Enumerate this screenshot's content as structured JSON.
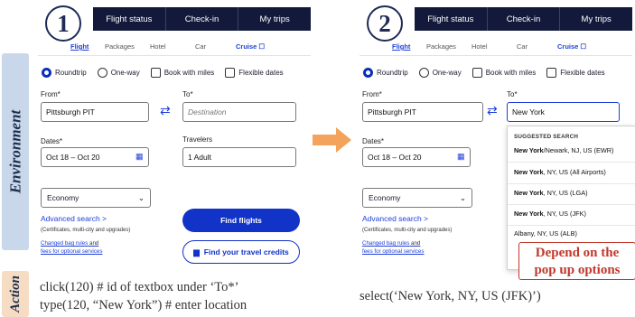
{
  "side_labels": {
    "environment": "Environment",
    "action": "Action"
  },
  "nav": {
    "items": [
      "Flight status",
      "Check-in",
      "My trips"
    ]
  },
  "steps": {
    "one": "1",
    "two": "2"
  },
  "tabs": {
    "flight": "Flight",
    "packages": "Packages",
    "hotel": "Hotel",
    "car": "Car",
    "cruise": "Cruise ☐"
  },
  "trip_options": {
    "roundtrip": "Roundtrip",
    "oneway": "One-way",
    "miles": "Book with miles",
    "flexible": "Flexible dates"
  },
  "form": {
    "from_label": "From*",
    "to_label": "To*",
    "from_value": "Pittsburgh PIT",
    "to_placeholder": "Destination",
    "to_value": "New York",
    "dates_label": "Dates*",
    "dates_value": "Oct 18 – Oct 20",
    "travelers_label": "Travelers",
    "travelers_value": "1 Adult",
    "cabin_value": "Economy",
    "advanced_label": "Advanced search >",
    "advanced_note": "(Certificates, multi-city and upgrades)",
    "bag_rules_1": "Changed bag rules",
    "bag_rules_and": " and",
    "bag_rules_2": "fees for optional services",
    "find_flights": "Find flights",
    "travel_credits": "Find your travel credits"
  },
  "suggestions": {
    "header": "SUGGESTED SEARCH",
    "items": [
      {
        "bold": "New York",
        "rest": "/Newark, NJ, US (EWR)"
      },
      {
        "bold": "New York",
        "rest": ", NY, US (All Airports)"
      },
      {
        "bold": "New York",
        "rest": ", NY, US (LGA)"
      },
      {
        "bold": "New York",
        "rest": ", NY, US (JFK)"
      },
      {
        "bold": "",
        "rest": "Albany, NY, US (ALB)"
      }
    ]
  },
  "callout": {
    "line1": "Depend on the",
    "line2": "pop up options"
  },
  "actions": {
    "step1_line1": "click(120) # id of textbox under ‘To*’",
    "step1_line2": "type(120, “New York”) # enter location",
    "step2": "select(‘New York, NY, US (JFK)’)"
  },
  "colors": {
    "nav": "#13193a",
    "accent": "#1233c8",
    "env_band": "#c9d7ea",
    "action_band": "#f7dcc4",
    "callout": "#c0392b",
    "arrow": "#f3a35b"
  }
}
